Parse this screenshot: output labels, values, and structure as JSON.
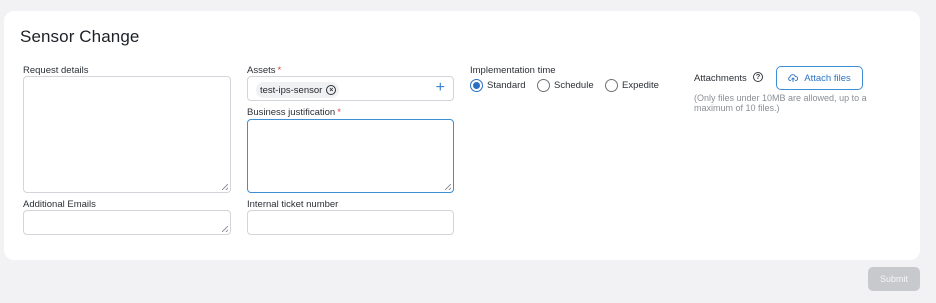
{
  "form": {
    "title": "Sensor Change",
    "request_details_label": "Request details",
    "additional_emails_label": "Additional Emails",
    "assets_label": "Assets",
    "required_mark": "*",
    "assets_chip": "test-ips-sensor",
    "chip_remove_glyph": "×",
    "add_asset_glyph": "+",
    "business_justification_label": "Business justification",
    "internal_ticket_label": "Internal ticket number",
    "implementation_time_label": "Implementation time",
    "implementation_options": [
      "Standard",
      "Schedule",
      "Expedite"
    ],
    "implementation_selected": "Standard",
    "attachments_label": "Attachments",
    "help_glyph": "?",
    "attach_button_label": "Attach files",
    "attachments_note": "(Only files under 10MB are allowed, up to a maximum of 10 files.)",
    "submit_label": "Submit"
  },
  "colors": {
    "accent": "#2a6fc4",
    "required": "#d8483e",
    "focus_border": "#3e8ed6",
    "disabled_button": "#c7c9cd"
  },
  "icons": {
    "chip_remove": "circle-x-icon",
    "add": "plus-icon",
    "help": "question-circle-icon",
    "attach": "cloud-upload-icon"
  }
}
